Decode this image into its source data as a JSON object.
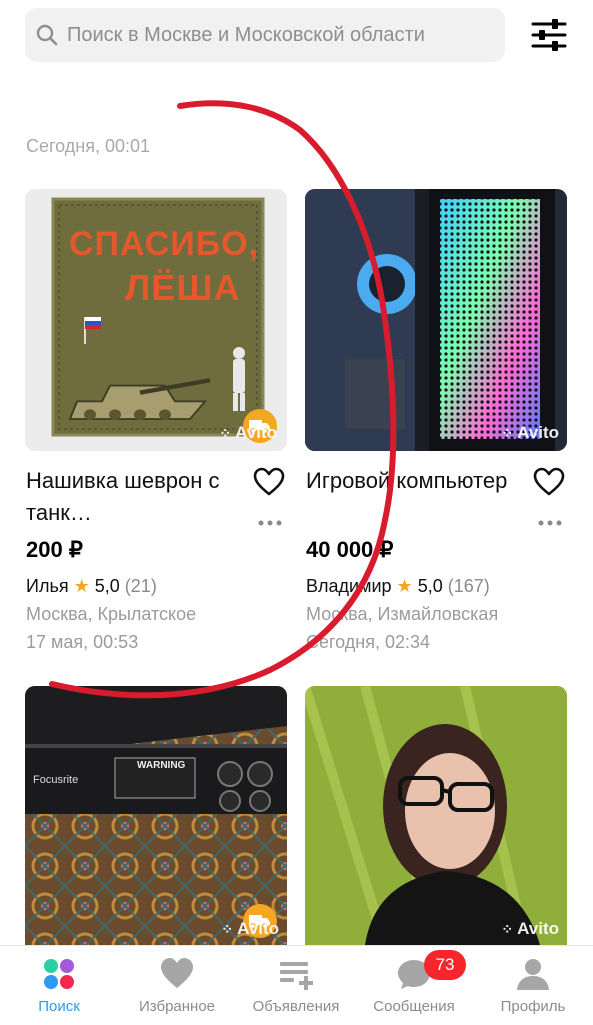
{
  "search": {
    "placeholder": "Поиск в Москве и Московской области"
  },
  "feed": {
    "date_label": "Сегодня, 00:01"
  },
  "listings": [
    {
      "title": "Нашивка шеврон с танк…",
      "price": "200 ₽",
      "seller": "Илья",
      "rating": "5,0",
      "reviews": "(21)",
      "location": "Москва, Крылатское",
      "time": "17 мая, 00:53",
      "has_delivery": true,
      "photo_text": [
        "СПАСИБО,",
        "ЛЁША"
      ],
      "watermark": "Avito"
    },
    {
      "title": "Игровой компьютер",
      "price": "40 000 ₽",
      "seller": "Владимир",
      "rating": "5,0",
      "reviews": "(167)",
      "location": "Москва, Измайловская",
      "time": "Сегодня, 02:34",
      "has_delivery": false,
      "watermark": "Avito"
    },
    {
      "photo_text": [
        "Focusrite",
        "WARNING"
      ],
      "has_delivery": true,
      "watermark": "Avito"
    },
    {
      "has_delivery": false,
      "watermark": "Avito"
    }
  ],
  "nav": {
    "items": [
      {
        "label": "Поиск",
        "icon": "search-dots-icon",
        "active": true
      },
      {
        "label": "Избранное",
        "icon": "heart-icon"
      },
      {
        "label": "Объявления",
        "icon": "add-listing-icon"
      },
      {
        "label": "Сообщения",
        "icon": "chat-bubble-icon",
        "badge": "73"
      },
      {
        "label": "Профиль",
        "icon": "profile-icon"
      }
    ]
  },
  "colors": {
    "accent": "#2b9bf4",
    "price": "#000000",
    "star": "#f6a623",
    "badge": "#f7262d",
    "delivery": "#f5a623",
    "scribble": "#d91c2d"
  }
}
